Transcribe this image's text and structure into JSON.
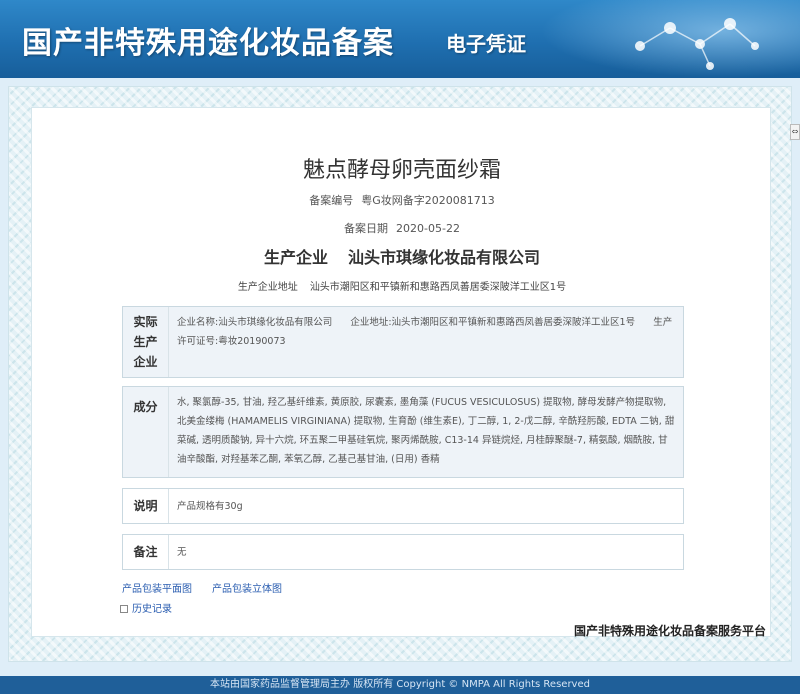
{
  "header": {
    "title": "国产非特殊用途化妆品备案",
    "subtitle": "电子凭证"
  },
  "certificate": {
    "product_name": "魅点酵母卵壳面纱霜",
    "record_no_label": "备案编号",
    "record_no": "粤G妆网备字2020081713",
    "record_date_label": "备案日期",
    "record_date": "2020-05-22",
    "manufacturer_label": "生产企业",
    "manufacturer": "汕头市琪缘化妆品有限公司",
    "manufacturer_addr_label": "生产企业地址",
    "manufacturer_addr": "汕头市潮阳区和平镇新和惠路西凤善居委深陂洋工业区1号"
  },
  "actual_company": {
    "side_label": "实际生产企业",
    "name_label": "企业名称:",
    "name": "汕头市琪缘化妆品有限公司",
    "addr_label": "企业地址:",
    "addr": "汕头市潮阳区和平镇新和惠路西凤善居委深陂洋工业区1号",
    "license_label": "生产许可证号:",
    "license": "粤妆20190073"
  },
  "ingredients": {
    "side_label": "成分",
    "text": "水, 聚氯醇-35, 甘油, 羟乙基纤维素, 黄原胶, 尿囊素, 墨角藻 (FUCUS VESICULOSUS) 提取物, 酵母发酵产物提取物, 北美金缕梅 (HAMAMELIS VIRGINIANA) 提取物, 生育酚 (维生素E), 丁二醇, 1, 2-戊二醇, 辛酰羟肟酸, EDTA 二钠, 甜菜碱, 透明质酸钠, 异十六烷, 环五聚二甲基硅氧烷, 聚丙烯酰胺, C13-14 异链烷烃, 月桂醇聚醚-7, 精氨酸, 烟酰胺, 甘油辛酸酯, 对羟基苯乙酮, 苯氧乙醇, 乙基己基甘油, (日用) 香精"
  },
  "notes": {
    "side_label": "说明",
    "text": "产品规格有30g"
  },
  "remarks": {
    "side_label": "备注",
    "text": "无"
  },
  "links": {
    "flat_view": "产品包装平面图",
    "3d_view": "产品包装立体图",
    "history": "历史记录"
  },
  "platform_name": "国产非特殊用途化妆品备案服务平台",
  "footer": "本站由国家药品监督管理局主办 版权所有 Copyright © NMPA All Rights Reserved"
}
